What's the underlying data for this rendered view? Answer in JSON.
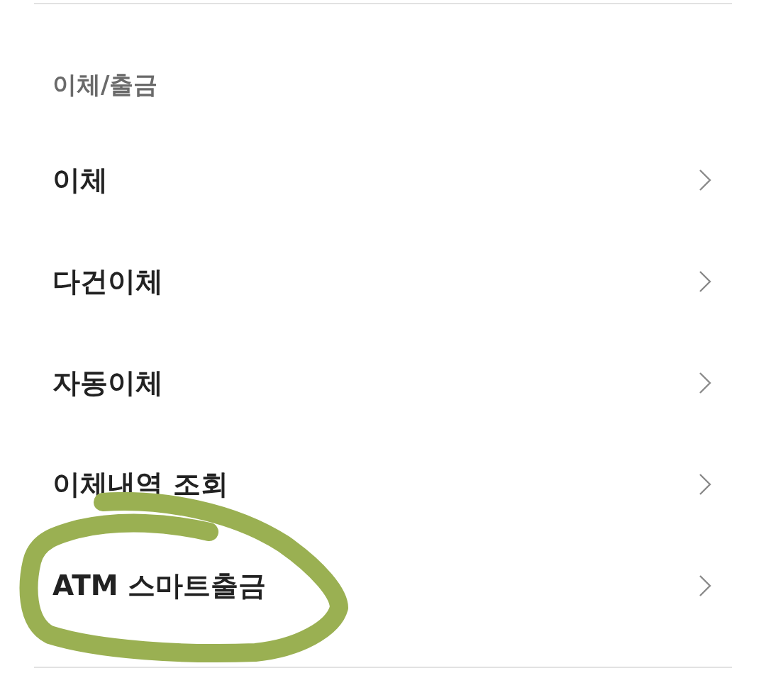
{
  "section": {
    "title": "이체/출금"
  },
  "items": [
    {
      "label": "이체",
      "circled": false
    },
    {
      "label": "다건이체",
      "circled": false
    },
    {
      "label": "자동이체",
      "circled": false
    },
    {
      "label": "이체내역 조회",
      "circled": false
    },
    {
      "label": "ATM 스마트출금",
      "circled": true
    }
  ]
}
